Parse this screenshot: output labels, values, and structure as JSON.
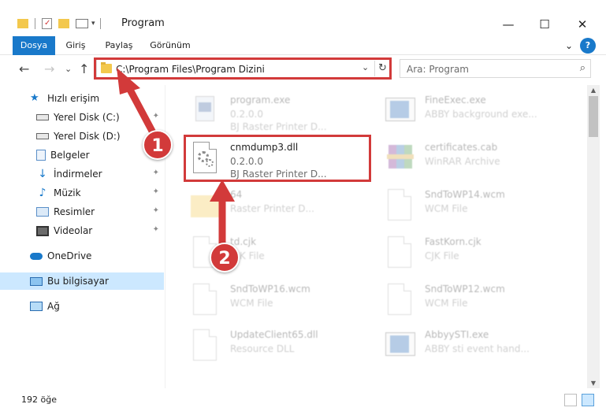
{
  "window": {
    "title": "Program",
    "minimize": "—",
    "maximize": "☐",
    "close": "✕"
  },
  "ribbon": {
    "tabs": [
      "Dosya",
      "Giriş",
      "Paylaş",
      "Görünüm"
    ],
    "expand": "⌄",
    "help": "?"
  },
  "nav": {
    "back": "←",
    "forward": "→",
    "dropdown": "⌄",
    "up": "↑",
    "address": "C:\\Program Files\\Program Dizini",
    "address_drop": "⌄",
    "refresh": "↻",
    "search_placeholder": "Ara: Program",
    "search_icon": "⌕"
  },
  "sidebar": {
    "items": [
      {
        "label": "Hızlı erişim",
        "icon": "star-icon",
        "pinned": false
      },
      {
        "label": "Yerel Disk (C:)",
        "icon": "drive-icon",
        "pinned": true
      },
      {
        "label": "Yerel Disk (D:)",
        "icon": "drive-icon",
        "pinned": false
      },
      {
        "label": "Belgeler",
        "icon": "documents-icon",
        "pinned": true
      },
      {
        "label": "İndirmeler",
        "icon": "downloads-icon",
        "pinned": true
      },
      {
        "label": "Müzik",
        "icon": "music-icon",
        "pinned": true
      },
      {
        "label": "Resimler",
        "icon": "pictures-icon",
        "pinned": true
      },
      {
        "label": "Videolar",
        "icon": "videos-icon",
        "pinned": true
      },
      {
        "label": "OneDrive",
        "icon": "cloud-icon",
        "pinned": false
      },
      {
        "label": "Bu bilgisayar",
        "icon": "computer-icon",
        "pinned": false
      },
      {
        "label": "Ağ",
        "icon": "network-icon",
        "pinned": false
      }
    ],
    "pin_glyph": "📌"
  },
  "files": [
    {
      "name": "program.exe",
      "line2": "0.2.0.0",
      "line3": "BJ Raster Printer D...",
      "icon": "program-exe-icon",
      "faded": true
    },
    {
      "name": "FineExec.exe",
      "line2": "ABBY background exe...",
      "line3": "",
      "icon": "fineexec-icon",
      "faded": true
    },
    {
      "name": "cnmdump3.dll",
      "line2": "0.2.0.0",
      "line3": "BJ Raster Printer D...",
      "icon": "dll-gear-icon",
      "faded": false
    },
    {
      "name": "certificates.cab",
      "line2": "WinRAR Archive",
      "line3": "",
      "icon": "winrar-icon",
      "faded": true
    },
    {
      "name": "64",
      "line2": "Raster Printer D...",
      "line3": "",
      "icon": "folder-icon",
      "faded": true
    },
    {
      "name": "SndToWP14.wcm",
      "line2": "WCM File",
      "line3": "",
      "icon": "blank-file-icon",
      "faded": true
    },
    {
      "name": "td.cjk",
      "line2": "CJK File",
      "line3": "",
      "icon": "blank-file-icon",
      "faded": true
    },
    {
      "name": "FastKorn.cjk",
      "line2": "CJK File",
      "line3": "",
      "icon": "blank-file-icon",
      "faded": true
    },
    {
      "name": "SndToWP16.wcm",
      "line2": "WCM File",
      "line3": "",
      "icon": "blank-file-icon",
      "faded": true
    },
    {
      "name": "SndToWP12.wcm",
      "line2": "WCM File",
      "line3": "",
      "icon": "blank-file-icon",
      "faded": true
    },
    {
      "name": "UpdateClient65.dll",
      "line2": "Resource DLL",
      "line3": "",
      "icon": "blank-file-icon",
      "faded": true
    },
    {
      "name": "AbbyySTI.exe",
      "line2": "ABBY sti event hand...",
      "line3": "",
      "icon": "abbyy-icon",
      "faded": true
    }
  ],
  "status": {
    "count": "192 öğe"
  },
  "annotations": {
    "badge1": "1",
    "badge2": "2"
  },
  "colors": {
    "accent": "#1979ca",
    "highlight": "#d23a3a",
    "selection": "#cce8ff"
  }
}
